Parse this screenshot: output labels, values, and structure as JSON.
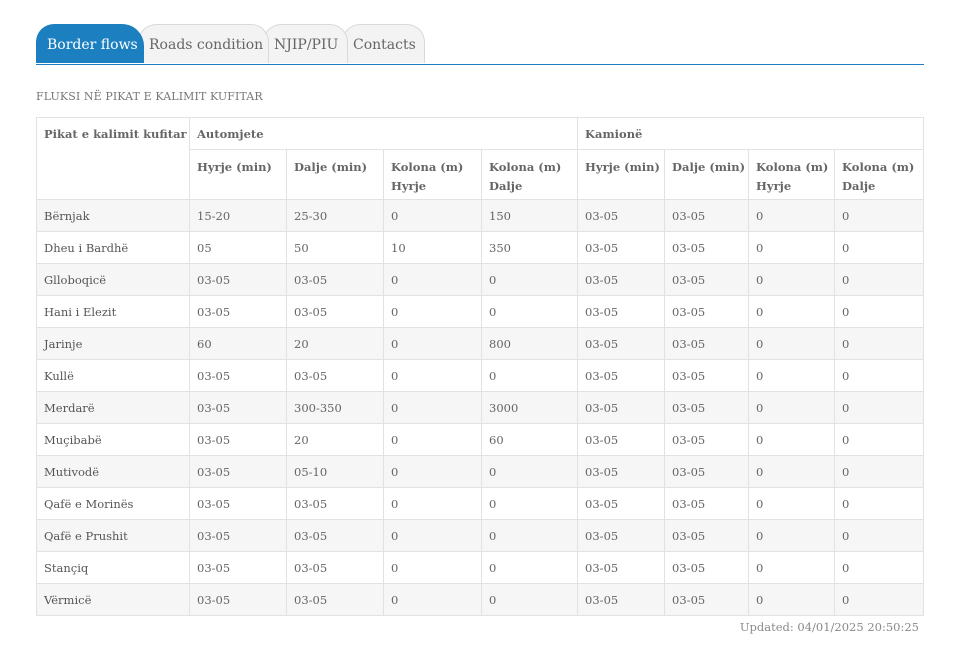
{
  "tabs": [
    {
      "label": "Border flows",
      "active": true
    },
    {
      "label": "Roads condition",
      "active": false
    },
    {
      "label": "NJIP/PIU",
      "active": false
    },
    {
      "label": "Contacts",
      "active": false
    }
  ],
  "colors": {
    "accent": "#1c7fc0",
    "row_alt": "#f6f6f6",
    "border": "#e2e2e2"
  },
  "section_title": "FLUKSI NË PIKAT E KALIMIT KUFITAR",
  "table": {
    "header_station": "Pikat e kalimit kufitar",
    "group_cars": "Automjete",
    "group_trucks": "Kamionë",
    "columns": [
      "Hyrje (min)",
      "Dalje (min)",
      "Kolona (m) Hyrje",
      "Kolona (m) Dalje",
      "Hyrje (min)",
      "Dalje (min)",
      "Kolona (m) Hyrje",
      "Kolona (m) Dalje"
    ],
    "rows": [
      {
        "name": "Bërnjak",
        "values": [
          "15-20",
          "25-30",
          "0",
          "150",
          "03-05",
          "03-05",
          "0",
          "0"
        ]
      },
      {
        "name": "Dheu i Bardhë",
        "values": [
          "05",
          "50",
          "10",
          "350",
          "03-05",
          "03-05",
          "0",
          "0"
        ]
      },
      {
        "name": "Glloboqicë",
        "values": [
          "03-05",
          "03-05",
          "0",
          "0",
          "03-05",
          "03-05",
          "0",
          "0"
        ]
      },
      {
        "name": "Hani i Elezit",
        "values": [
          "03-05",
          "03-05",
          "0",
          "0",
          "03-05",
          "03-05",
          "0",
          "0"
        ]
      },
      {
        "name": "Jarinje",
        "values": [
          "60",
          "20",
          "0",
          "800",
          "03-05",
          "03-05",
          "0",
          "0"
        ]
      },
      {
        "name": "Kullë",
        "values": [
          "03-05",
          "03-05",
          "0",
          "0",
          "03-05",
          "03-05",
          "0",
          "0"
        ]
      },
      {
        "name": "Merdarë",
        "values": [
          "03-05",
          "300-350",
          "0",
          "3000",
          "03-05",
          "03-05",
          "0",
          "0"
        ]
      },
      {
        "name": "Muçibabë",
        "values": [
          "03-05",
          "20",
          "0",
          "60",
          "03-05",
          "03-05",
          "0",
          "0"
        ]
      },
      {
        "name": "Mutivodë",
        "values": [
          "03-05",
          "05-10",
          "0",
          "0",
          "03-05",
          "03-05",
          "0",
          "0"
        ]
      },
      {
        "name": "Qafë e Morinës",
        "values": [
          "03-05",
          "03-05",
          "0",
          "0",
          "03-05",
          "03-05",
          "0",
          "0"
        ]
      },
      {
        "name": "Qafë e Prushit",
        "values": [
          "03-05",
          "03-05",
          "0",
          "0",
          "03-05",
          "03-05",
          "0",
          "0"
        ]
      },
      {
        "name": "Stançiq",
        "values": [
          "03-05",
          "03-05",
          "0",
          "0",
          "03-05",
          "03-05",
          "0",
          "0"
        ]
      },
      {
        "name": "Vërmicë",
        "values": [
          "03-05",
          "03-05",
          "0",
          "0",
          "03-05",
          "03-05",
          "0",
          "0"
        ]
      }
    ]
  },
  "updated": "Updated: 04/01/2025 20:50:25"
}
